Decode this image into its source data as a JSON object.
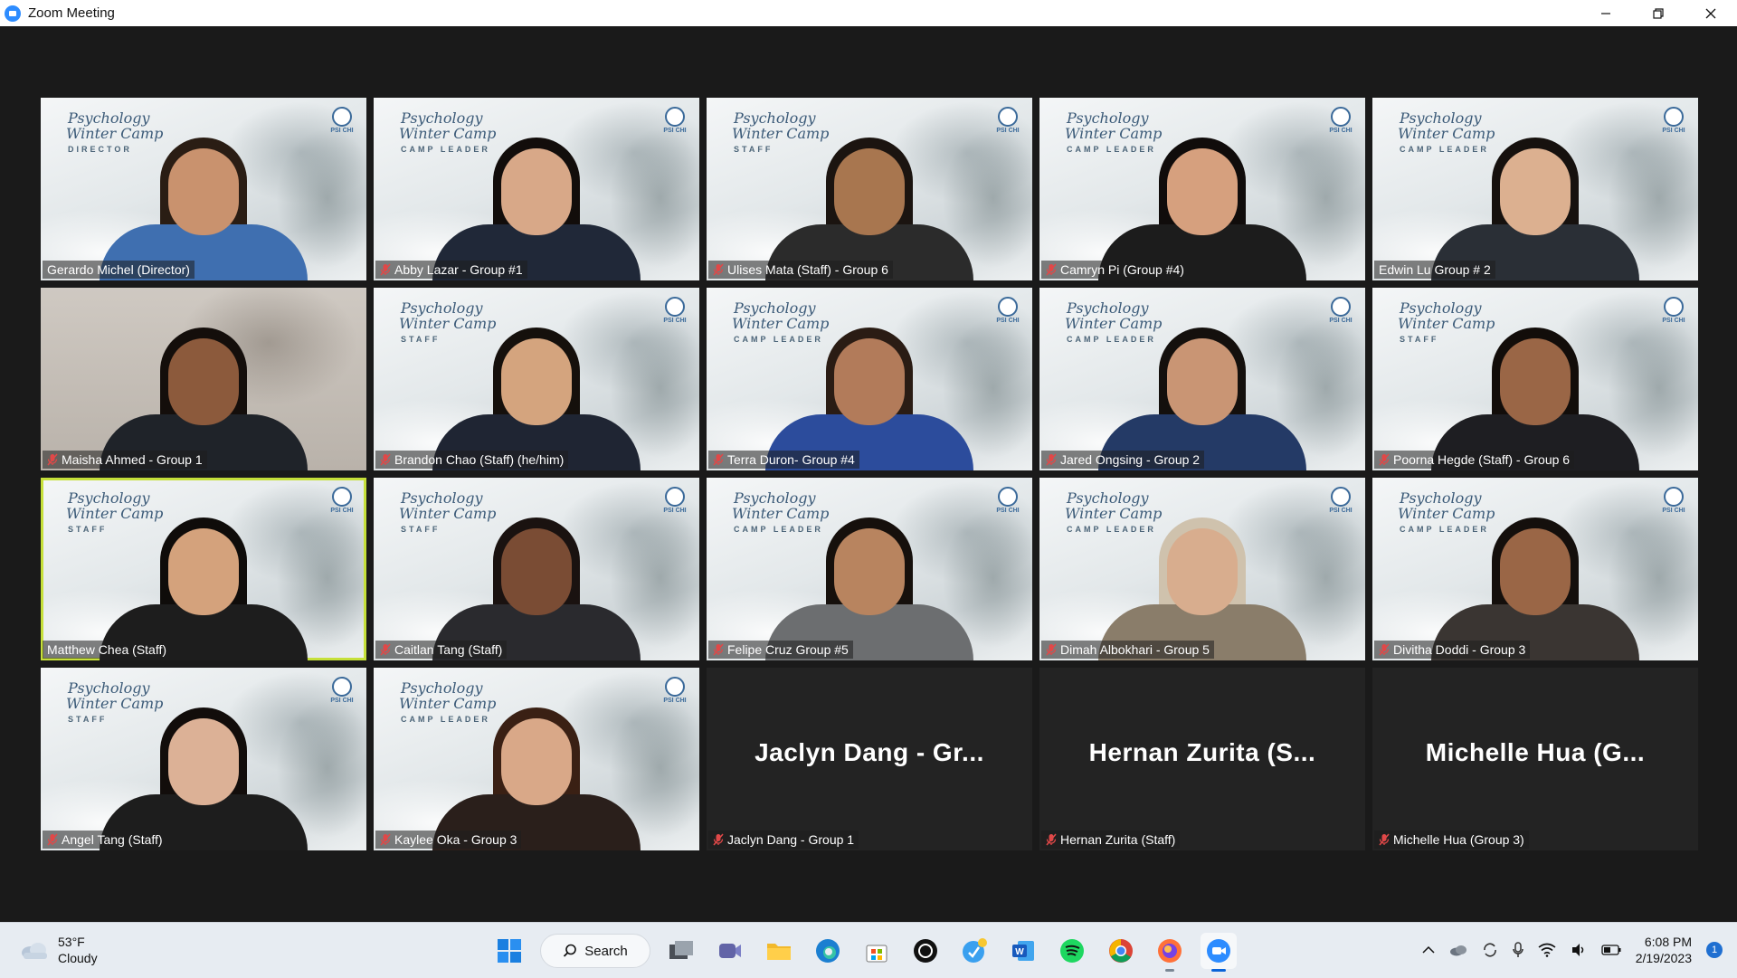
{
  "window": {
    "title": "Zoom Meeting",
    "controls": [
      "minimize-icon",
      "restore-icon",
      "close-icon"
    ]
  },
  "branding": {
    "line1": "Psychology",
    "line2": "Winter Camp",
    "badge": "PSI CHI"
  },
  "participants": [
    {
      "name": "Gerardo Michel (Director)",
      "role": "DIRECTOR",
      "muted": false,
      "bg": "snow",
      "skin": "#c9926e",
      "hair": "#2a1d14",
      "shirt": "#3f6fb0"
    },
    {
      "name": "Abby Lazar - Group #1",
      "role": "CAMP LEADER",
      "muted": true,
      "bg": "snow",
      "skin": "#d8a888",
      "hair": "#120d0b",
      "shirt": "#202838"
    },
    {
      "name": "Ulises Mata (Staff) - Group 6",
      "role": "STAFF",
      "muted": true,
      "bg": "snow",
      "skin": "#a8764f",
      "hair": "#1b1410",
      "shirt": "#2b2b2b"
    },
    {
      "name": "Camryn Pi (Group #4)",
      "role": "CAMP LEADER",
      "muted": true,
      "bg": "snow",
      "skin": "#d6a07e",
      "hair": "#100c0b",
      "shirt": "#1c1c1c"
    },
    {
      "name": "Edwin Lu Group # 2",
      "role": "CAMP LEADER",
      "muted": false,
      "bg": "snow",
      "skin": "#dcb090",
      "hair": "#16110e",
      "shirt": "#2a2f36"
    },
    {
      "name": "Maisha Ahmed - Group 1",
      "role": "",
      "muted": true,
      "bg": "plain",
      "skin": "#8c5a3c",
      "hair": "#140e0b",
      "shirt": "#1f2329"
    },
    {
      "name": "Brandon Chao (Staff) (he/him)",
      "role": "STAFF",
      "muted": true,
      "bg": "snow",
      "skin": "#d4a47e",
      "hair": "#15100c",
      "shirt": "#1f2533"
    },
    {
      "name": "Terra Duron- Group #4",
      "role": "CAMP LEADER",
      "muted": true,
      "bg": "snow",
      "skin": "#b27b5a",
      "hair": "#2a1c14",
      "shirt": "#2c4c9c"
    },
    {
      "name": "Jared Ongsing - Group 2",
      "role": "CAMP LEADER",
      "muted": true,
      "bg": "snow",
      "skin": "#c99574",
      "hair": "#14100d",
      "shirt": "#243a66"
    },
    {
      "name": "Poorna Hegde (Staff) - Group 6",
      "role": "STAFF",
      "muted": true,
      "bg": "snow",
      "skin": "#9a6646",
      "hair": "#120d0a",
      "shirt": "#1e1e22"
    },
    {
      "name": "Matthew Chea (Staff)",
      "role": "STAFF",
      "muted": false,
      "bg": "snow",
      "skin": "#d4a27c",
      "hair": "#0f0c0a",
      "shirt": "#1d1d1d",
      "active": true
    },
    {
      "name": "Caitlan Tang (Staff)",
      "role": "STAFF",
      "muted": true,
      "bg": "snow",
      "skin": "#7a4c34",
      "hair": "#1a1210",
      "shirt": "#2a2a2e"
    },
    {
      "name": "Felipe Cruz Group #5",
      "role": "CAMP LEADER",
      "muted": true,
      "bg": "snow",
      "skin": "#b8845f",
      "hair": "#16100c",
      "shirt": "#6c6e70"
    },
    {
      "name": "Dimah Albokhari - Group 5",
      "role": "CAMP LEADER",
      "muted": true,
      "bg": "snow",
      "skin": "#d8ad8e",
      "hair": "#cfc2ad",
      "shirt": "#8a7d6a"
    },
    {
      "name": "Divitha Doddi - Group 3",
      "role": "CAMP LEADER",
      "muted": true,
      "bg": "snow",
      "skin": "#9a6646",
      "hair": "#140f0c",
      "shirt": "#3a3532"
    },
    {
      "name": "Angel Tang (Staff)",
      "role": "STAFF",
      "muted": true,
      "bg": "snow",
      "skin": "#dcb196",
      "hair": "#120d0b",
      "shirt": "#1d1d1d"
    },
    {
      "name": "Kaylee Oka - Group 3",
      "role": "CAMP LEADER",
      "muted": true,
      "bg": "snow",
      "skin": "#d9a888",
      "hair": "#3a2014",
      "shirt": "#2a1f1b"
    },
    {
      "name": "Jaclyn Dang - Group 1",
      "display": "Jaclyn Dang - Gr...",
      "muted": true,
      "bg": "dark"
    },
    {
      "name": "Hernan Zurita (Staff)",
      "display": "Hernan Zurita (S...",
      "muted": true,
      "bg": "dark"
    },
    {
      "name": "Michelle Hua (Group 3)",
      "display": "Michelle Hua (G...",
      "muted": true,
      "bg": "dark"
    }
  ],
  "taskbar": {
    "weather": {
      "temp": "53°F",
      "condition": "Cloudy"
    },
    "search_label": "Search",
    "apps": [
      "task-view-icon",
      "teams-icon",
      "file-explorer-icon",
      "edge-icon",
      "store-icon",
      "chatgpt-icon",
      "reminder-icon",
      "word-icon",
      "spotify-icon",
      "chrome-icon",
      "firefox-icon",
      "zoom-icon"
    ],
    "clock": {
      "time": "6:08 PM",
      "date": "2/19/2023"
    },
    "notifications": "1"
  }
}
